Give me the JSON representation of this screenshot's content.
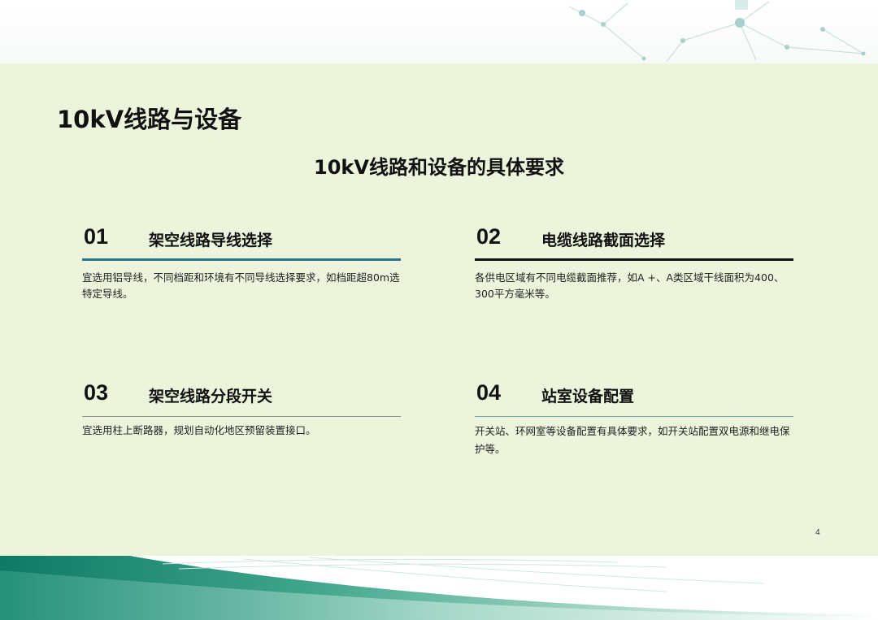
{
  "page_title": "10kV线路与设备",
  "subtitle": "10kV线路和设备的具体要求",
  "sections": [
    {
      "number": "01",
      "title": "架空线路导线选择",
      "body": "宜选用铝导线，不同档距和环境有不同导线选择要求，如档距超80m选特定导线。"
    },
    {
      "number": "02",
      "title": "电缆线路截面选择",
      "body": "各供电区域有不同电缆截面推荐，如A +、A类区域干线面积为400、300平方毫米等。"
    },
    {
      "number": "03",
      "title": "架空线路分段开关",
      "body": "宜选用柱上断路器，规划自动化地区预留装置接口。"
    },
    {
      "number": "04",
      "title": "站室设备配置",
      "body": "开关站、环网室等设备配置有具体要求，如开关站配置双电源和继电保护等。"
    }
  ],
  "page_number": "4",
  "colors": {
    "panel_background": "#ecf5dc",
    "rule_teal": "#2a7688",
    "rule_black": "#111111",
    "rule_gray": "#8a8f88",
    "rule_light_teal": "#6aa3ad",
    "accent_green": "#1f8a70"
  }
}
